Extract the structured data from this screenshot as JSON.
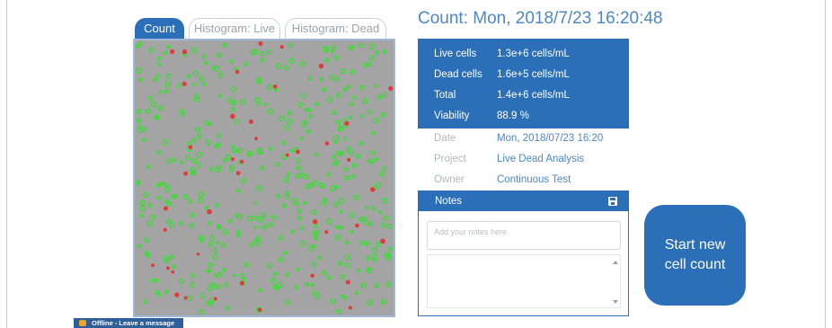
{
  "tabs": [
    {
      "label": "Count",
      "active": true
    },
    {
      "label": "Histogram: Live",
      "active": false
    },
    {
      "label": "Histogram: Dead",
      "active": false
    }
  ],
  "title": "Count: Mon, 2018/7/23 16:20:48",
  "stats": [
    {
      "label": "Live cells",
      "value": "1.3e+6 cells/mL"
    },
    {
      "label": "Dead cells",
      "value": "1.6e+5 cells/mL"
    },
    {
      "label": "Total",
      "value": "1.4e+6 cells/mL"
    },
    {
      "label": "Viability",
      "value": "88.9 %"
    }
  ],
  "meta": [
    {
      "label": "Date",
      "value": "Mon, 2018/07/23 16:20"
    },
    {
      "label": "Project",
      "value": "Live Dead Analysis"
    },
    {
      "label": "Owner",
      "value": "Continuous Test"
    }
  ],
  "notes": {
    "header": "Notes",
    "placeholder": "Add your notes here",
    "save_icon": "save-icon"
  },
  "start_button": "Start new cell count",
  "offline": {
    "label": "Offline - Leave a message",
    "icon": "chat-icon"
  },
  "colors": {
    "accent": "#2a6fb8",
    "live_cell": "#34e02c",
    "dead_cell": "#e03a3a",
    "image_bg": "#a4a4a4"
  }
}
